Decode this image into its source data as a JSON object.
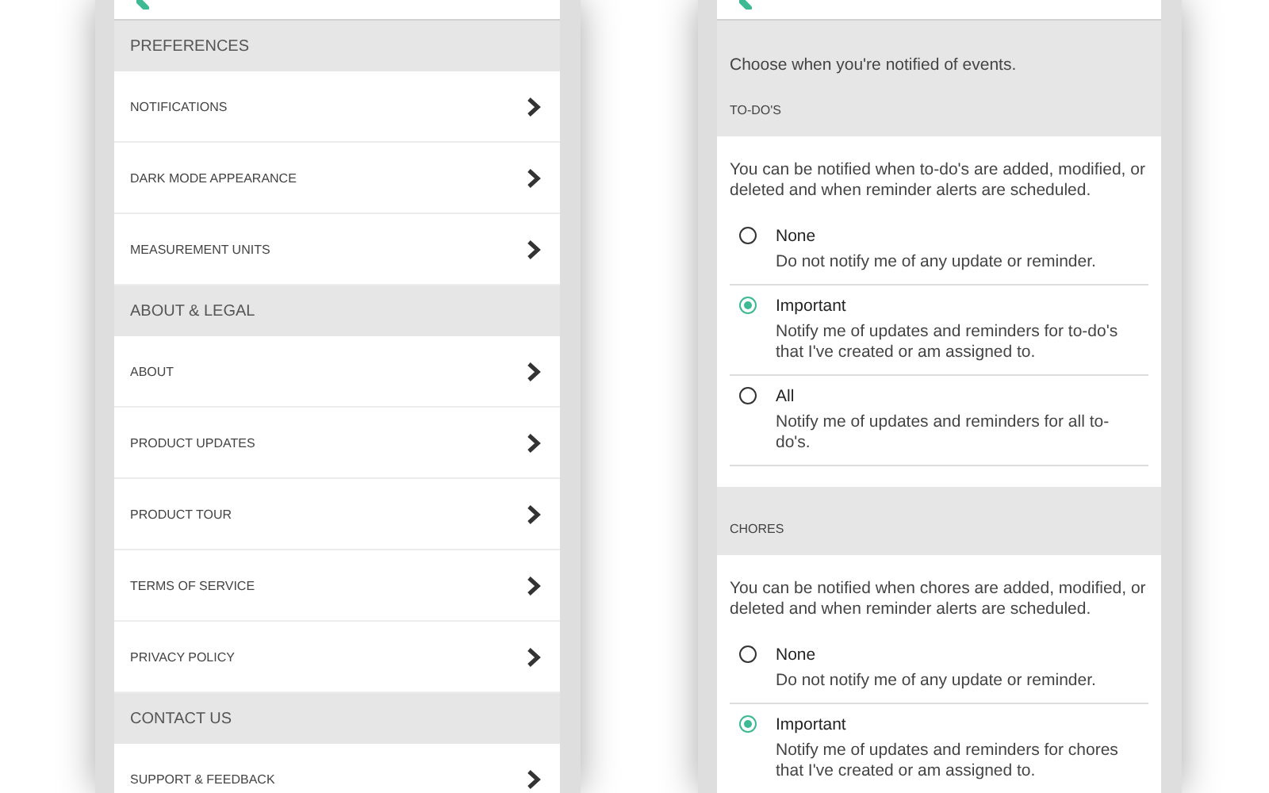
{
  "settings": {
    "sections": [
      {
        "title": "PREFERENCES",
        "items": [
          {
            "label": "NOTIFICATIONS"
          },
          {
            "label": "DARK MODE APPEARANCE"
          },
          {
            "label": "MEASUREMENT UNITS"
          }
        ]
      },
      {
        "title": "ABOUT & LEGAL",
        "items": [
          {
            "label": "ABOUT"
          },
          {
            "label": "PRODUCT UPDATES"
          },
          {
            "label": "PRODUCT TOUR"
          },
          {
            "label": "TERMS OF SERVICE"
          },
          {
            "label": "PRIVACY POLICY"
          }
        ]
      },
      {
        "title": "CONTACT US",
        "items": [
          {
            "label": "SUPPORT & FEEDBACK"
          }
        ]
      }
    ]
  },
  "notifications": {
    "intro": "Choose when you're notified of events.",
    "groups": [
      {
        "title": "TO-DO'S",
        "description": "You can be notified when to-do's are added, modified, or deleted and when reminder alerts are scheduled.",
        "options": [
          {
            "label": "None",
            "description": "Do not notify me of any update or reminder.",
            "selected": false
          },
          {
            "label": "Important",
            "description": "Notify me of updates and reminders for to-do's that I've created or am assigned to.",
            "selected": true
          },
          {
            "label": "All",
            "description": "Notify me of updates and reminders for all to-do's.",
            "selected": false
          }
        ]
      },
      {
        "title": "CHORES",
        "description": "You can be notified when chores are added, modified, or deleted and when reminder alerts are scheduled.",
        "options": [
          {
            "label": "None",
            "description": "Do not notify me of any update or reminder.",
            "selected": false
          },
          {
            "label": "Important",
            "description": "Notify me of updates and reminders for chores that I've created or am assigned to.",
            "selected": true
          }
        ]
      }
    ]
  }
}
